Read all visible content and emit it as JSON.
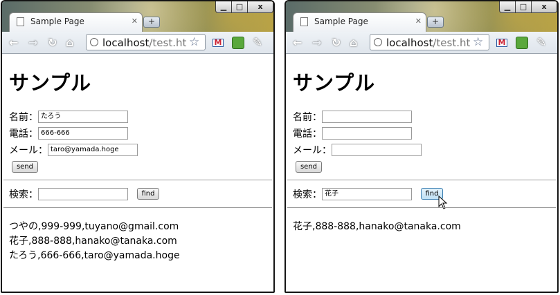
{
  "windows": [
    {
      "tab_title": "Sample Page",
      "url_host": "localhost",
      "url_path": "/test.ht",
      "heading": "サンプル",
      "form": {
        "name_label": "名前：",
        "name_value": "たろう",
        "phone_label": "電話：",
        "phone_value": "666-666",
        "mail_label": "メール：",
        "mail_value": "taro@yamada.hoge",
        "send_label": "send"
      },
      "search": {
        "label": "検索：",
        "value": "",
        "find_label": "find"
      },
      "results": [
        "つやの,999-999,tuyano@gmail.com",
        "花子,888-888,hanako@tanaka.com",
        "たろう,666-666,taro@yamada.hoge"
      ]
    },
    {
      "tab_title": "Sample Page",
      "url_host": "localhost",
      "url_path": "/test.ht",
      "heading": "サンプル",
      "form": {
        "name_label": "名前：",
        "name_value": "",
        "phone_label": "電話：",
        "phone_value": "",
        "mail_label": "メール：",
        "mail_value": "",
        "send_label": "send"
      },
      "search": {
        "label": "検索：",
        "value": "花子",
        "find_label": "find"
      },
      "results": [
        "花子,888-888,hanako@tanaka.com"
      ]
    }
  ],
  "window_controls": {
    "minimize": "▁",
    "maximize": "□",
    "close": "x"
  },
  "toolbar_icons": [
    "back-icon",
    "forward-icon",
    "reload-icon",
    "home-icon",
    "star-icon",
    "gmail-icon",
    "evernote-icon",
    "wrench-icon"
  ],
  "colors": {
    "find_hover": "#bfe0f4",
    "frame": "#141414"
  }
}
